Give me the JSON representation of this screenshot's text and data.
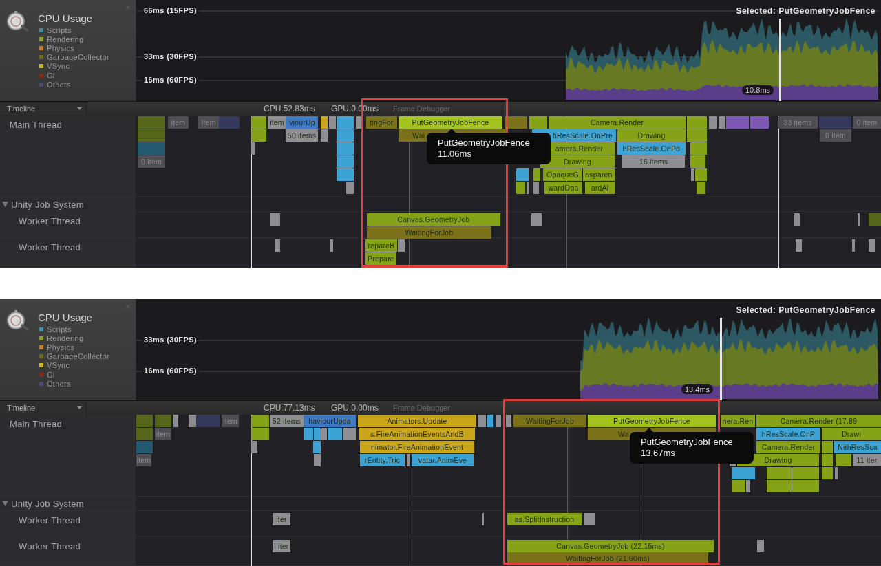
{
  "panels": [
    {
      "legend": {
        "title": "CPU Usage",
        "close": "×",
        "items": [
          {
            "label": "Scripts",
            "color": "#3a8fa8"
          },
          {
            "label": "Rendering",
            "color": "#8ca01e"
          },
          {
            "label": "Physics",
            "color": "#d07a1a"
          },
          {
            "label": "GarbageCollector",
            "color": "#6b6b1a"
          },
          {
            "label": "VSync",
            "color": "#c8b41e"
          },
          {
            "label": "Gi",
            "color": "#8a2a14"
          },
          {
            "label": "Others",
            "color": "#4a4a7a"
          }
        ]
      },
      "graph": {
        "gridlines": [
          "66ms (15FPS)",
          "33ms (30FPS)",
          "16ms (60FPS)"
        ],
        "selected": "Selected: PutGeometryJobFence",
        "marker": "10.8ms"
      },
      "toolbar": {
        "view": "Timeline",
        "cpu": "CPU:52.83ms",
        "gpu": "GPU:0.00ms",
        "frame_debugger": "Frame Debugger"
      },
      "threads": [
        {
          "name": "Main Thread",
          "kind": "thread"
        },
        {
          "name": "Unity Job System",
          "kind": "group",
          "expanded": true
        },
        {
          "name": "Worker Thread",
          "kind": "worker"
        },
        {
          "name": "Worker Thread",
          "kind": "worker"
        }
      ],
      "bars": [
        {
          "color": "#55661a"
        },
        {
          "label": "item",
          "color": "#4d4d52"
        },
        {
          "label": "Item",
          "color": "#4d4d52"
        },
        {
          "color": "#34385a"
        },
        {
          "color": "#86a317"
        },
        {
          "label": "item",
          "color": "#8f8f93"
        },
        {
          "label": "viourUp",
          "color": "#3f79c4"
        },
        {
          "color": "#c9a51b"
        },
        {
          "color": "#8f8f93"
        },
        {
          "color": "#3da2d4"
        },
        {
          "color": "#8f8f93"
        },
        {
          "label": "tingFor",
          "color": "#7b7118"
        },
        {
          "label": "PutGeometryJobFence",
          "color": "#a3c41e"
        },
        {
          "color": "#7b7118"
        },
        {
          "color": "#86a317"
        },
        {
          "label": "Camera.Render",
          "color": "#86a317"
        },
        {
          "color": "#86a317"
        },
        {
          "color": "#8f8f93"
        },
        {
          "color": "#8f8f93"
        },
        {
          "color": "#7d57b4"
        },
        {
          "color": "#7d57b4"
        },
        {
          "label": "33 items",
          "color": "#4d4d52"
        },
        {
          "color": "#34385a"
        },
        {
          "label": "0 item",
          "color": "#4d4d52"
        },
        {
          "color": "#55661a"
        },
        {
          "color": "#86a317"
        },
        {
          "label": "50 items",
          "color": "#8f8f93"
        },
        {
          "color": "#8f8f93"
        },
        {
          "color": "#3da2d4"
        },
        {
          "label": "Wai",
          "color": "#7b7118"
        },
        {
          "label": "hResScale.OnPre",
          "color": "#3da2d4"
        },
        {
          "label": "Drawing",
          "color": "#86a317"
        },
        {
          "color": "#86a317"
        },
        {
          "label": "0 item",
          "color": "#4d4d52"
        },
        {
          "color": "#245a70"
        },
        {
          "color": "#8f8f93"
        },
        {
          "color": "#3da2d4"
        },
        {
          "label": "amera.Render",
          "color": "#86a317"
        },
        {
          "label": "hResScale.OnPo",
          "color": "#3da2d4"
        },
        {
          "color": "#86a317"
        },
        {
          "label": "0 item",
          "color": "#4d4d52"
        },
        {
          "color": "#3da2d4"
        },
        {
          "label": "Drawing",
          "color": "#86a317"
        },
        {
          "label": "16 items",
          "color": "#8f8f93"
        },
        {
          "color": "#86a317"
        },
        {
          "color": "#3da2d4"
        },
        {
          "color": "#3da2d4"
        },
        {
          "color": "#86a317"
        },
        {
          "label": "OpaqueG",
          "color": "#86a317"
        },
        {
          "label": "nsparen",
          "color": "#86a317"
        },
        {
          "color": "#8f8f93"
        },
        {
          "color": "#86a317"
        },
        {
          "color": "#8f8f93"
        },
        {
          "color": "#86a317"
        },
        {
          "color": "#8f8f93"
        },
        {
          "color": "#8f8f93"
        },
        {
          "label": "wardOpa",
          "color": "#86a317"
        },
        {
          "label": "ardAl",
          "color": "#86a317"
        },
        {
          "color": "#86a317"
        },
        {
          "color": "#8f8f93"
        },
        {
          "label": "Canvas.GeometryJob",
          "color": "#86a317"
        },
        {
          "color": "#8f8f93"
        },
        {
          "color": "#8f8f93"
        },
        {
          "color": "#8f8f93"
        },
        {
          "color": "#55661a"
        },
        {
          "label": "WaitingForJob",
          "color": "#7b7118"
        },
        {
          "color": "#8f8f93"
        },
        {
          "color": "#8f8f93"
        },
        {
          "label": "repareB",
          "color": "#86a317"
        },
        {
          "color": "#8f8f93"
        },
        {
          "color": "#8f8f93"
        },
        {
          "color": "#8f8f93"
        },
        {
          "color": "#8f8f93"
        },
        {
          "label": "Prepare",
          "color": "#86a317"
        }
      ],
      "tooltip": {
        "title": "PutGeometryJobFence",
        "time": "11.06ms"
      }
    },
    {
      "legend": {
        "title": "CPU Usage",
        "close": "×",
        "items": [
          {
            "label": "Scripts",
            "color": "#3a8fa8"
          },
          {
            "label": "Rendering",
            "color": "#8ca01e"
          },
          {
            "label": "Physics",
            "color": "#d07a1a"
          },
          {
            "label": "GarbageCollector",
            "color": "#6b6b1a"
          },
          {
            "label": "VSync",
            "color": "#c8b41e"
          },
          {
            "label": "Gi",
            "color": "#8a2a14"
          },
          {
            "label": "Others",
            "color": "#4a4a7a"
          }
        ]
      },
      "graph": {
        "gridlines": [
          "33ms (30FPS)",
          "16ms (60FPS)"
        ],
        "selected": "Selected: PutGeometryJobFence",
        "marker": "13.4ms"
      },
      "toolbar": {
        "view": "Timeline",
        "cpu": "CPU:77.13ms",
        "gpu": "GPU:0.00ms",
        "frame_debugger": "Frame Debugger"
      },
      "threads": [
        {
          "name": "Main Thread",
          "kind": "thread"
        },
        {
          "name": "Unity Job System",
          "kind": "group",
          "expanded": true
        },
        {
          "name": "Worker Thread",
          "kind": "worker"
        },
        {
          "name": "Worker Thread",
          "kind": "worker"
        }
      ],
      "bars": [
        {
          "color": "#55661a"
        },
        {
          "color": "#55661a"
        },
        {
          "color": "#8f8f93"
        },
        {
          "color": "#8f8f93"
        },
        {
          "color": "#34385a"
        },
        {
          "label": "item",
          "color": "#4d4d52"
        },
        {
          "color": "#86a317"
        },
        {
          "label": "52 items",
          "color": "#8f8f93"
        },
        {
          "label": "haviourUpda",
          "color": "#3f79c4"
        },
        {
          "label": "Animators.Update",
          "color": "#c9a51b"
        },
        {
          "color": "#8f8f93"
        },
        {
          "color": "#3da2d4"
        },
        {
          "color": "#8f8f93"
        },
        {
          "color": "#8f8f93"
        },
        {
          "label": "WaitingForJob",
          "color": "#7b7118"
        },
        {
          "label": "PutGeometryJobFence",
          "color": "#a3c41e"
        },
        {
          "label": "nera.Ren",
          "color": "#86a317"
        },
        {
          "label": "Camera.Render (17.89",
          "color": "#86a317"
        },
        {
          "color": "#55661a"
        },
        {
          "label": "item",
          "color": "#4d4d52"
        },
        {
          "color": "#86a317"
        },
        {
          "color": "#3da2d4"
        },
        {
          "color": "#3da2d4"
        },
        {
          "color": "#8f8f93"
        },
        {
          "color": "#3da2d4"
        },
        {
          "color": "#8f8f93"
        },
        {
          "label": "s.FireAnimationEventsAndB",
          "color": "#c9a51b"
        },
        {
          "label": "Wa",
          "color": "#7b7118"
        },
        {
          "label": "hResScale.OnP",
          "color": "#3da2d4"
        },
        {
          "label": "Drawi",
          "color": "#86a317"
        },
        {
          "color": "#245a70"
        },
        {
          "color": "#8f8f93"
        },
        {
          "color": "#3da2d4"
        },
        {
          "label": "nimator.FireAnimationEvent",
          "color": "#c9a51b"
        },
        {
          "label": "Camera.Render",
          "color": "#86a317"
        },
        {
          "color": "#86a317"
        },
        {
          "label": "NithResSca",
          "color": "#3da2d4"
        },
        {
          "label": "item",
          "color": "#4d4d52"
        },
        {
          "color": "#8f8f93"
        },
        {
          "label": "rEntity.Tric",
          "color": "#3da2d4"
        },
        {
          "color": "#8f8f93"
        },
        {
          "label": "vatar.AnimEve",
          "color": "#3da2d4"
        },
        {
          "color": "#8f8f93"
        },
        {
          "label": "Drawing",
          "color": "#86a317"
        },
        {
          "color": "#86a317"
        },
        {
          "color": "#86a317"
        },
        {
          "label": "11 iter",
          "color": "#8f8f93"
        },
        {
          "color": "#3da2d4"
        },
        {
          "color": "#86a317"
        },
        {
          "color": "#86a317"
        },
        {
          "color": "#86a317"
        },
        {
          "color": "#8f8f93"
        },
        {
          "color": "#86a317"
        },
        {
          "color": "#8f8f93"
        },
        {
          "color": "#86a317"
        },
        {
          "color": "#86a317"
        },
        {
          "label": "iter",
          "color": "#8f8f93"
        },
        {
          "color": "#8f8f93"
        },
        {
          "label": "as.SplitInstruction",
          "color": "#86a317"
        },
        {
          "color": "#8f8f93"
        },
        {
          "label": "l iter",
          "color": "#8f8f93"
        },
        {
          "label": "Canvas.GeometryJob (22.15ms)",
          "color": "#86a317"
        },
        {
          "color": "#8f8f93"
        },
        {
          "label": "WaitingForJob (21.60ms)",
          "color": "#7b7118"
        }
      ],
      "tooltip": {
        "title": "PutGeometryJobFence",
        "time": "13.67ms"
      }
    }
  ]
}
